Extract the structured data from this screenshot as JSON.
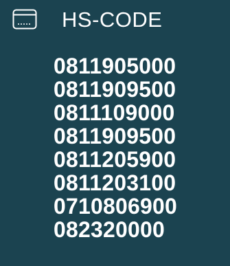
{
  "header": {
    "label": "HS-CODE",
    "icon": "window-icon"
  },
  "codes": [
    "0811905000",
    "0811909500",
    "0811109000",
    "0811909500",
    "0811205900",
    "0811203100",
    "0710806900",
    "082320000"
  ],
  "colors": {
    "background": "#1b4350",
    "text": "#ffffff"
  }
}
